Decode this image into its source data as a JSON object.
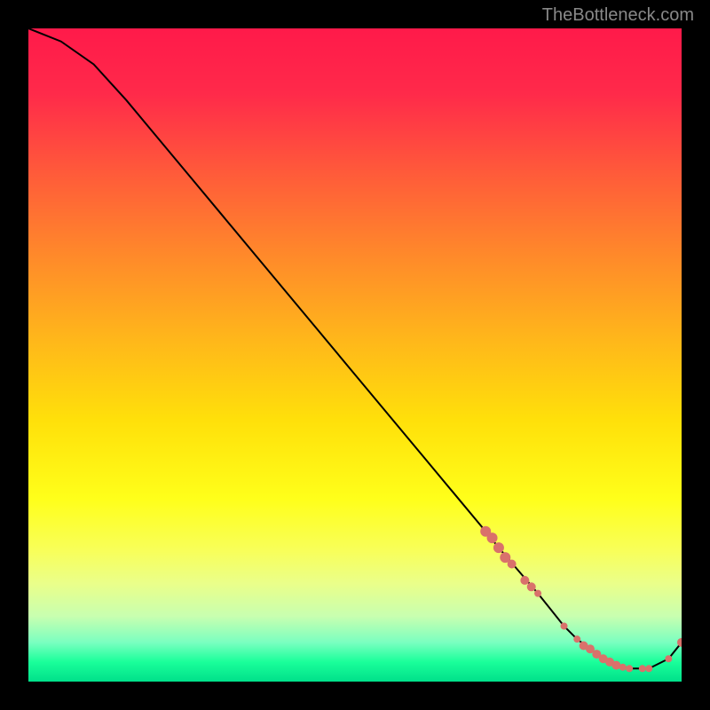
{
  "watermark": "TheBottleneck.com",
  "colors": {
    "background": "#000000",
    "marker": "#d9716b",
    "line": "#000000"
  },
  "chart_data": {
    "type": "line",
    "title": "",
    "xlabel": "",
    "ylabel": "",
    "xlim": [
      0,
      100
    ],
    "ylim": [
      0,
      100
    ],
    "grid": false,
    "legend": false,
    "series": [
      {
        "name": "curve",
        "x": [
          0,
          5,
          10,
          15,
          20,
          25,
          30,
          35,
          40,
          45,
          50,
          55,
          60,
          65,
          70,
          72,
          75,
          78,
          80,
          82,
          84,
          86,
          88,
          90,
          92,
          95,
          98,
          100
        ],
        "y": [
          100,
          98,
          94.5,
          89,
          83,
          77,
          71,
          65,
          59,
          53,
          47,
          41,
          35,
          29,
          23,
          20.5,
          17,
          13.5,
          11,
          8.5,
          6.5,
          5,
          3.5,
          2.5,
          2,
          2,
          3.5,
          6
        ],
        "color": "#000000"
      }
    ],
    "markers": [
      {
        "x": 70,
        "y": 23,
        "r": 6
      },
      {
        "x": 71,
        "y": 22,
        "r": 6
      },
      {
        "x": 72,
        "y": 20.5,
        "r": 6
      },
      {
        "x": 73,
        "y": 19,
        "r": 6
      },
      {
        "x": 74,
        "y": 18,
        "r": 5
      },
      {
        "x": 76,
        "y": 15.5,
        "r": 5
      },
      {
        "x": 77,
        "y": 14.5,
        "r": 5
      },
      {
        "x": 78,
        "y": 13.5,
        "r": 4
      },
      {
        "x": 82,
        "y": 8.5,
        "r": 4
      },
      {
        "x": 84,
        "y": 6.5,
        "r": 4
      },
      {
        "x": 85,
        "y": 5.5,
        "r": 5
      },
      {
        "x": 86,
        "y": 5,
        "r": 5
      },
      {
        "x": 87,
        "y": 4.2,
        "r": 5
      },
      {
        "x": 88,
        "y": 3.5,
        "r": 5
      },
      {
        "x": 89,
        "y": 3,
        "r": 5
      },
      {
        "x": 90,
        "y": 2.5,
        "r": 5
      },
      {
        "x": 91,
        "y": 2.2,
        "r": 4
      },
      {
        "x": 92,
        "y": 2,
        "r": 4
      },
      {
        "x": 94,
        "y": 2,
        "r": 4
      },
      {
        "x": 95,
        "y": 2,
        "r": 4
      },
      {
        "x": 98,
        "y": 3.5,
        "r": 4
      },
      {
        "x": 100,
        "y": 6,
        "r": 5
      }
    ],
    "gradient_stops": [
      {
        "pos": 0,
        "color": "#ff1a4a"
      },
      {
        "pos": 50,
        "color": "#ffe00a"
      },
      {
        "pos": 80,
        "color": "#f8ff5a"
      },
      {
        "pos": 100,
        "color": "#00e08a"
      }
    ]
  }
}
